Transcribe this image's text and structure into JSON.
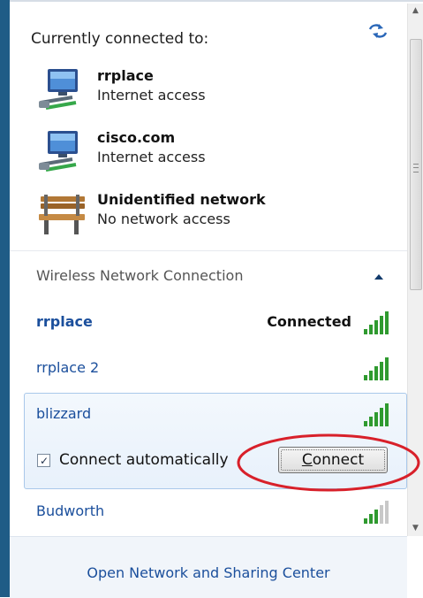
{
  "header": {
    "title": "Currently connected to:",
    "refresh_icon": "refresh-icon"
  },
  "connections": [
    {
      "name": "rrplace",
      "status": "Internet access",
      "icon": "network-icon"
    },
    {
      "name": "cisco.com",
      "status": "Internet access",
      "icon": "network-icon"
    },
    {
      "name": "Unidentified network",
      "status": "No network access",
      "icon": "park-bench-icon"
    }
  ],
  "wireless": {
    "section_title": "Wireless Network Connection",
    "collapse_icon": "chevron-up-icon",
    "networks": [
      {
        "name": "rrplace",
        "state": "Connected",
        "signal": 5
      },
      {
        "name": "rrplace 2",
        "state": "",
        "signal": 5
      },
      {
        "name": "blizzard",
        "state": "",
        "signal": 5
      },
      {
        "name": "Budworth",
        "state": "",
        "signal": 3
      }
    ],
    "selected": {
      "checkbox_label": "Connect automatically",
      "checked": true,
      "connect_label_u": "C",
      "connect_label_rest": "onnect"
    }
  },
  "footer": {
    "link": "Open Network and Sharing Center"
  },
  "colors": {
    "link": "#1b4f9c",
    "highlight": "#e8f1fb",
    "annotation": "#d8202a",
    "signal": "#2f9a2f"
  }
}
